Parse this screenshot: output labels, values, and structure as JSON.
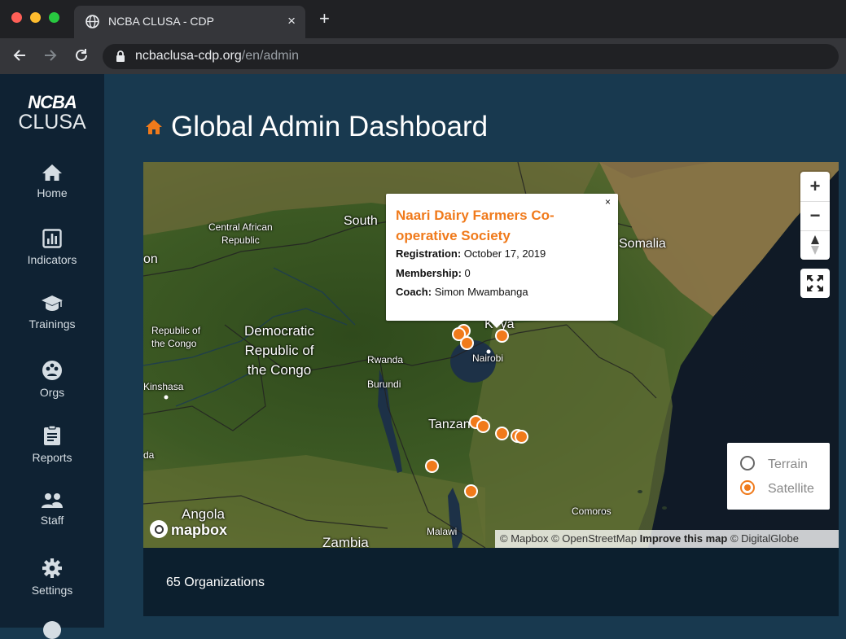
{
  "browser": {
    "tab_title": "NCBA CLUSA - CDP",
    "tab_close": "×",
    "new_tab": "+",
    "url_host": "ncbaclusa-cdp.org",
    "url_path": "/en/admin"
  },
  "sidebar": {
    "logo_line1": "NCBA",
    "logo_line2": "CLUSA",
    "items": [
      {
        "label": "Home",
        "icon": "home-icon"
      },
      {
        "label": "Indicators",
        "icon": "bar-chart-icon"
      },
      {
        "label": "Trainings",
        "icon": "graduation-cap-icon"
      },
      {
        "label": "Orgs",
        "icon": "organizations-icon"
      },
      {
        "label": "Reports",
        "icon": "clipboard-icon"
      },
      {
        "label": "Staff",
        "icon": "users-icon"
      },
      {
        "label": "Settings",
        "icon": "gear-icon"
      }
    ]
  },
  "header": {
    "title": "Global Admin Dashboard"
  },
  "map": {
    "labels": {
      "south": "South",
      "car": "Central African\nRepublic",
      "on": "on",
      "roc": "Republic of\nthe Congo",
      "drc": "Democratic\nRepublic of\nthe Congo",
      "rwanda": "Rwanda",
      "burundi": "Burundi",
      "kinshasa": "Kinshasa",
      "da": "da",
      "tanzania": "Tanzan",
      "angola": "Angola",
      "zambia": "Zambia",
      "malawi": "Malawi",
      "comoros": "Comoros",
      "somalia": "Somalia",
      "nairobi": "Nairobi",
      "kenya": "K  ya"
    },
    "popup": {
      "title": "Naari Dairy Farmers Co-operative Society",
      "close": "×",
      "registration_label": "Registration:",
      "registration_value": "October 17, 2019",
      "membership_label": "Membership:",
      "membership_value": "0",
      "coach_label": "Coach:",
      "coach_value": "Simon Mwambanga"
    },
    "controls": {
      "zoom_in": "+",
      "zoom_out": "−"
    },
    "layers": {
      "terrain": "Terrain",
      "satellite": "Satellite",
      "selected": "Satellite"
    },
    "attribution": {
      "mapbox": "© Mapbox",
      "osm": "© OpenStreetMap",
      "improve": "Improve this map",
      "digitalglobe": "© DigitalGlobe"
    },
    "brand": "mapbox",
    "marker_color": "#f07a1b"
  },
  "footer": {
    "organizations_count": "65 Organizations"
  }
}
